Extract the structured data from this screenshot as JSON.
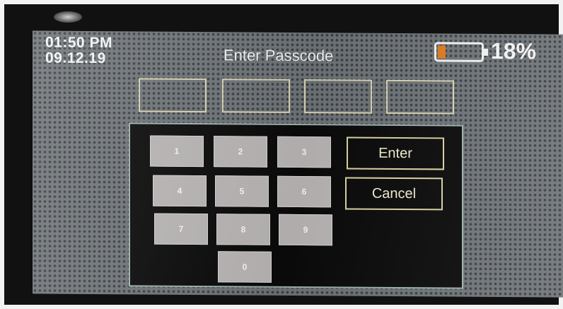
{
  "status": {
    "time": "01:50 PM",
    "date": "09.12.19",
    "battery_percent": "18%",
    "battery_level": 0.18,
    "battery_fill_color": "#e07a1b"
  },
  "screen": {
    "title": "Enter Passcode"
  },
  "passcode": {
    "slots": [
      "",
      "",
      "",
      ""
    ]
  },
  "keypad": {
    "keys": [
      "1",
      "2",
      "3",
      "4",
      "5",
      "6",
      "7",
      "8",
      "9",
      "0"
    ]
  },
  "actions": {
    "enter_label": "Enter",
    "cancel_label": "Cancel"
  }
}
